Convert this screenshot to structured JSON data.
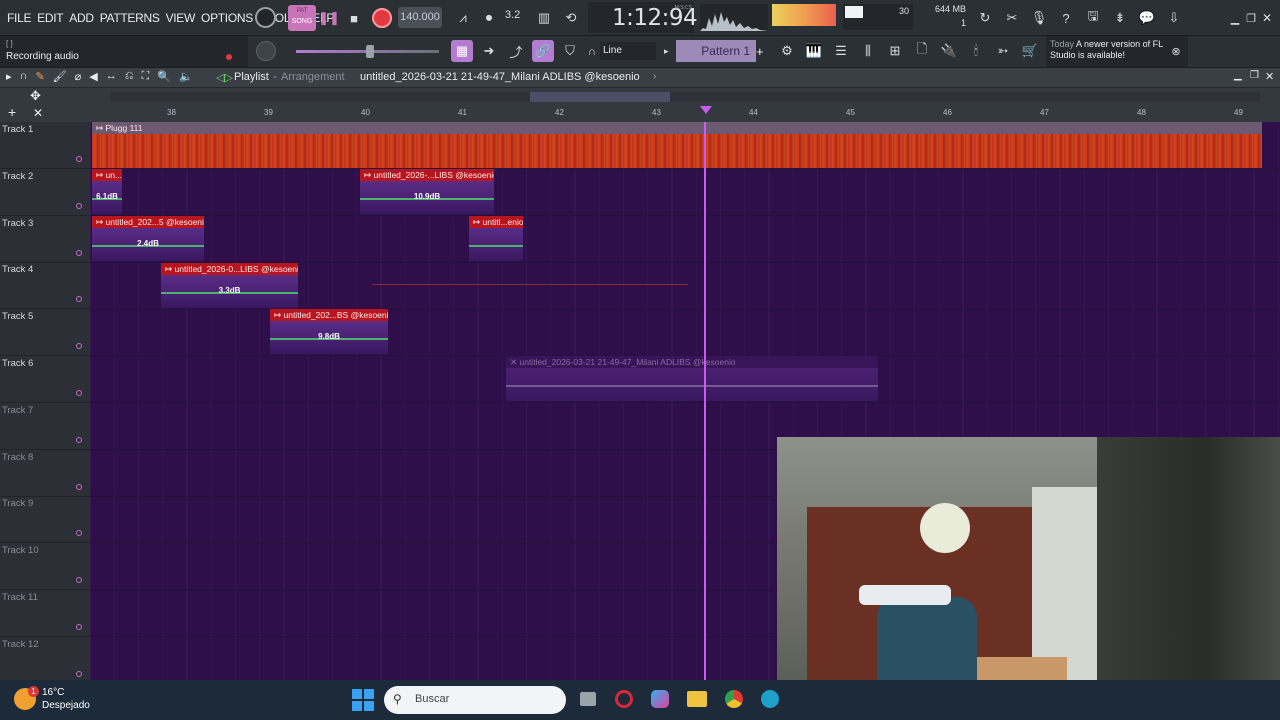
{
  "menu": [
    "FILE",
    "EDIT",
    "ADD",
    "PATTERNS",
    "VIEW",
    "OPTIONS",
    "TOOLS",
    "HELP"
  ],
  "transport": {
    "mode_pat": "PAT",
    "mode_song": "SONG",
    "tempo": "140.000",
    "time": "1:12:94",
    "time_unit": "M:S:CS",
    "cpu": "30",
    "memory": "644 MB",
    "voices": "1",
    "snap": "3.2"
  },
  "hint": {
    "bracket": "[ ]",
    "text": "Recording audio"
  },
  "snap_mode": "Line",
  "pattern": "Pattern 1",
  "news": {
    "label": "Today",
    "message": "A newer version of FL Studio is available!"
  },
  "playlist": {
    "title": "Playlist",
    "subtitle": "Arrangement",
    "project": "untitled_2026-03-21 21-49-47_Milani ADLIBS @kesoenio"
  },
  "bars": [
    "38",
    "39",
    "40",
    "41",
    "42",
    "43",
    "44",
    "45",
    "46",
    "47",
    "48",
    "49"
  ],
  "tracks": [
    "Track 1",
    "Track 2",
    "Track 3",
    "Track 4",
    "Track 5",
    "Track 6",
    "Track 7",
    "Track 8",
    "Track 9",
    "Track 10",
    "Track 11",
    "Track 12"
  ],
  "clips": [
    {
      "name": "Plugg 111",
      "track": 1,
      "db": ""
    },
    {
      "name": "un...",
      "track": 2,
      "db": "6.1dB"
    },
    {
      "name": "untitled_2026-...LIBS @kesoenio",
      "track": 2,
      "db": "10.9dB"
    },
    {
      "name": "untitled_202...5 @kesoenio",
      "track": 3,
      "db": "2.4dB"
    },
    {
      "name": "untitl...enio",
      "track": 3,
      "db": ""
    },
    {
      "name": "untitled_2026-0...LIBS @kesoenio",
      "track": 4,
      "db": "3.3dB"
    },
    {
      "name": "untitled_202...BS @kesoenio",
      "track": 5,
      "db": "9.8dB"
    },
    {
      "name": "untitled_2026-03-21 21-49-47_Milani ADLIBS @kesoenio",
      "track": 6,
      "db": ""
    }
  ],
  "taskbar": {
    "temp": "16°C",
    "weather": "Despejado",
    "search": "Buscar",
    "notif": "1"
  },
  "colors": {
    "grid_bg": "#2e0f4a",
    "clip_red": "#b7161e",
    "clip_purple": "#5a2c86",
    "playhead": "#c85cf0"
  }
}
